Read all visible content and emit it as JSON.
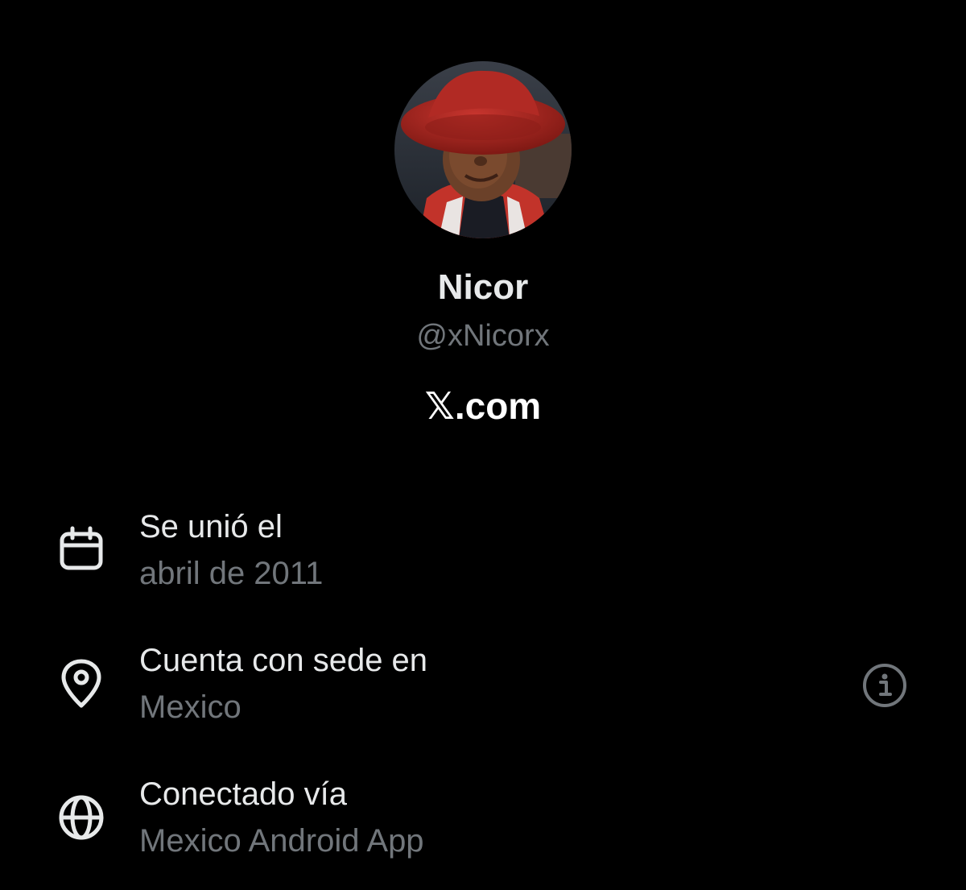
{
  "profile": {
    "display_name": "Nicor",
    "handle": "@xNicorx",
    "website": "𝕏.com",
    "avatar_icon": "profile-photo"
  },
  "about": {
    "joined": {
      "label": "Se unió el",
      "value": "abril de 2011",
      "icon": "calendar-icon"
    },
    "location": {
      "label": "Cuenta con sede en",
      "value": "Mexico",
      "icon": "location-pin-icon",
      "info_icon": "info-icon"
    },
    "connected": {
      "label": "Conectado vía",
      "value": "Mexico Android App",
      "icon": "globe-icon"
    }
  },
  "colors": {
    "background": "#000000",
    "primary_text": "#e7e9ea",
    "secondary_text": "#71767b"
  }
}
